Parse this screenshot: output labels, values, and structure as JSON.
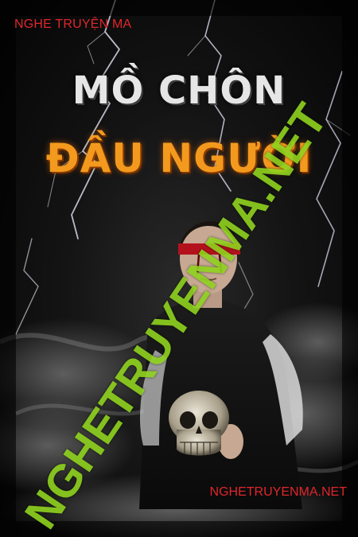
{
  "cover": {
    "top_label": "NGHE TRUYỆN MA",
    "title_line1": "MỒ CHÔN",
    "title_line2": "ĐẦU NGƯỜI",
    "watermark": "NGHETRUYENMA.NET",
    "bottom_label": "NGHETRUYENMA.NET"
  },
  "colors": {
    "label_red": "#e0262b",
    "title_silver": "#e6e6e6",
    "title_orange": "#f39a1e",
    "watermark_green": "#8fd21e",
    "background": "#0b0b0b"
  },
  "image_elements": [
    "lightning",
    "smoke",
    "blindfolded-figure",
    "skull"
  ]
}
